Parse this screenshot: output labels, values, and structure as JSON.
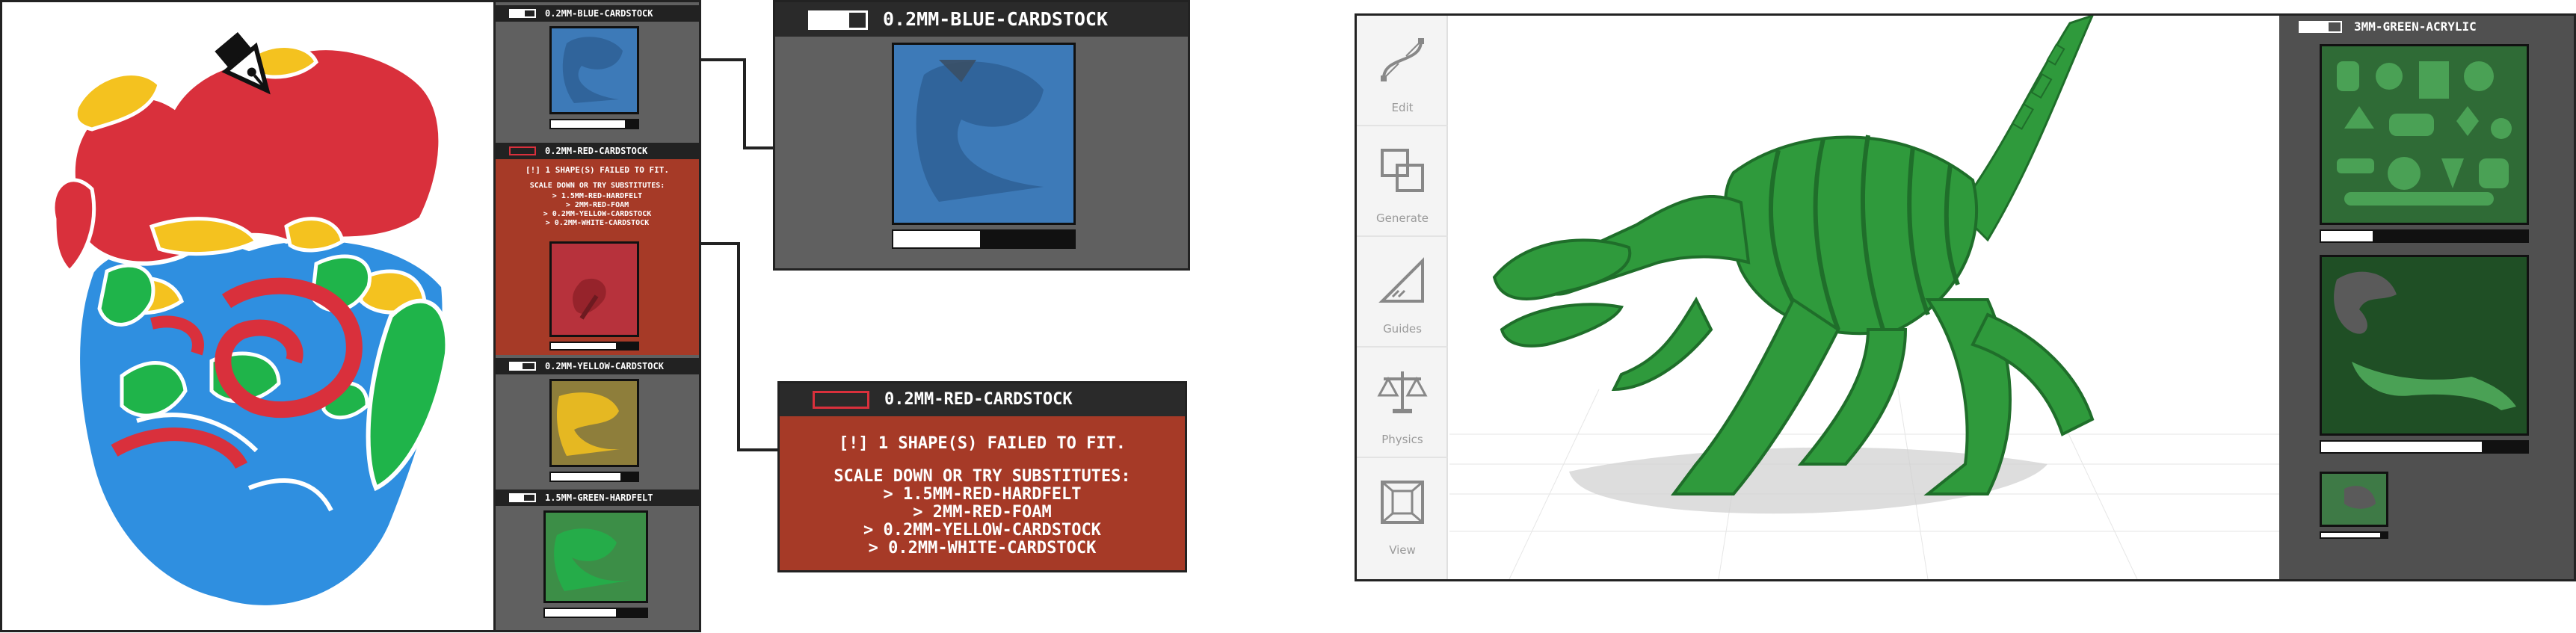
{
  "left_app": {
    "materials": [
      {
        "name": "0.2MM-BLUE-CARDSTOCK",
        "color": "#3d7ab8",
        "progress": 0.85
      },
      {
        "name": "0.2MM-RED-CARDSTOCK",
        "color": "#b7323c",
        "progress": 0.75,
        "error": {
          "message": "[!] 1 SHAPE(S) FAILED TO FIT.",
          "hint": "SCALE DOWN OR TRY SUBSTITUTES:",
          "substitutes": [
            "> 1.5MM-RED-HARDFELT",
            "> 2MM-RED-FOAM",
            "> 0.2MM-YELLOW-CARDSTOCK",
            "> 0.2MM-WHITE-CARDSTOCK"
          ]
        }
      },
      {
        "name": "0.2MM-YELLOW-CARDSTOCK",
        "color": "#8e7e3b",
        "progress": 0.8
      },
      {
        "name": "1.5MM-GREEN-HARDFELT",
        "color": "#3c8e47",
        "progress": 0.7
      }
    ]
  },
  "callouts": {
    "blue": {
      "title": "0.2MM-BLUE-CARDSTOCK",
      "progress": 0.48
    },
    "red": {
      "title": "0.2MM-RED-CARDSTOCK",
      "message": "[!] 1 SHAPE(S) FAILED TO FIT.",
      "hint": "SCALE DOWN OR TRY SUBSTITUTES:",
      "substitutes": [
        "> 1.5MM-RED-HARDFELT",
        "> 2MM-RED-FOAM",
        "> 0.2MM-YELLOW-CARDSTOCK",
        "> 0.2MM-WHITE-CARDSTOCK"
      ]
    }
  },
  "right_app": {
    "tools": [
      {
        "label": "Edit",
        "icon": "bezier-pen-icon"
      },
      {
        "label": "Generate",
        "icon": "generate-squares-icon"
      },
      {
        "label": "Guides",
        "icon": "triangle-ruler-icon"
      },
      {
        "label": "Physics",
        "icon": "balance-scale-icon"
      },
      {
        "label": "View",
        "icon": "cube-view-icon"
      }
    ],
    "panel": {
      "title": "3MM-GREEN-ACRYLIC",
      "sheets": [
        {
          "progress": 0.25
        },
        {
          "progress": 0.78
        },
        {
          "progress": 0.9
        }
      ]
    }
  },
  "colors": {
    "red": "#d9303c",
    "blue": "#2f8fe0",
    "yellow": "#f4c21f",
    "green": "#1fb44a",
    "error_panel": "#a63a27",
    "panel_gray": "#606060",
    "acrylic_green": "#2f9a3c"
  }
}
